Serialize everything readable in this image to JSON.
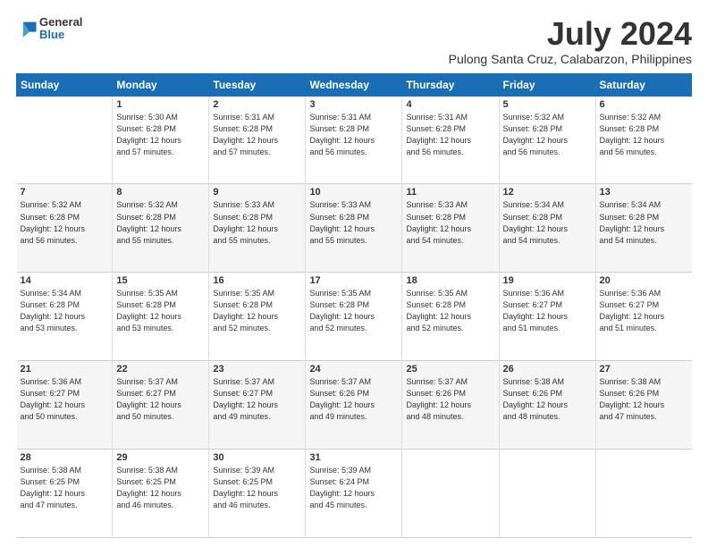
{
  "logo": {
    "general": "General",
    "blue": "Blue"
  },
  "title": "July 2024",
  "subtitle": "Pulong Santa Cruz, Calabarzon, Philippines",
  "days_header": [
    "Sunday",
    "Monday",
    "Tuesday",
    "Wednesday",
    "Thursday",
    "Friday",
    "Saturday"
  ],
  "weeks": [
    [
      {
        "num": "",
        "info": ""
      },
      {
        "num": "1",
        "info": "Sunrise: 5:30 AM\nSunset: 6:28 PM\nDaylight: 12 hours\nand 57 minutes."
      },
      {
        "num": "2",
        "info": "Sunrise: 5:31 AM\nSunset: 6:28 PM\nDaylight: 12 hours\nand 57 minutes."
      },
      {
        "num": "3",
        "info": "Sunrise: 5:31 AM\nSunset: 6:28 PM\nDaylight: 12 hours\nand 56 minutes."
      },
      {
        "num": "4",
        "info": "Sunrise: 5:31 AM\nSunset: 6:28 PM\nDaylight: 12 hours\nand 56 minutes."
      },
      {
        "num": "5",
        "info": "Sunrise: 5:32 AM\nSunset: 6:28 PM\nDaylight: 12 hours\nand 56 minutes."
      },
      {
        "num": "6",
        "info": "Sunrise: 5:32 AM\nSunset: 6:28 PM\nDaylight: 12 hours\nand 56 minutes."
      }
    ],
    [
      {
        "num": "7",
        "info": "Sunrise: 5:32 AM\nSunset: 6:28 PM\nDaylight: 12 hours\nand 56 minutes."
      },
      {
        "num": "8",
        "info": "Sunrise: 5:32 AM\nSunset: 6:28 PM\nDaylight: 12 hours\nand 55 minutes."
      },
      {
        "num": "9",
        "info": "Sunrise: 5:33 AM\nSunset: 6:28 PM\nDaylight: 12 hours\nand 55 minutes."
      },
      {
        "num": "10",
        "info": "Sunrise: 5:33 AM\nSunset: 6:28 PM\nDaylight: 12 hours\nand 55 minutes."
      },
      {
        "num": "11",
        "info": "Sunrise: 5:33 AM\nSunset: 6:28 PM\nDaylight: 12 hours\nand 54 minutes."
      },
      {
        "num": "12",
        "info": "Sunrise: 5:34 AM\nSunset: 6:28 PM\nDaylight: 12 hours\nand 54 minutes."
      },
      {
        "num": "13",
        "info": "Sunrise: 5:34 AM\nSunset: 6:28 PM\nDaylight: 12 hours\nand 54 minutes."
      }
    ],
    [
      {
        "num": "14",
        "info": "Sunrise: 5:34 AM\nSunset: 6:28 PM\nDaylight: 12 hours\nand 53 minutes."
      },
      {
        "num": "15",
        "info": "Sunrise: 5:35 AM\nSunset: 6:28 PM\nDaylight: 12 hours\nand 53 minutes."
      },
      {
        "num": "16",
        "info": "Sunrise: 5:35 AM\nSunset: 6:28 PM\nDaylight: 12 hours\nand 52 minutes."
      },
      {
        "num": "17",
        "info": "Sunrise: 5:35 AM\nSunset: 6:28 PM\nDaylight: 12 hours\nand 52 minutes."
      },
      {
        "num": "18",
        "info": "Sunrise: 5:35 AM\nSunset: 6:28 PM\nDaylight: 12 hours\nand 52 minutes."
      },
      {
        "num": "19",
        "info": "Sunrise: 5:36 AM\nSunset: 6:27 PM\nDaylight: 12 hours\nand 51 minutes."
      },
      {
        "num": "20",
        "info": "Sunrise: 5:36 AM\nSunset: 6:27 PM\nDaylight: 12 hours\nand 51 minutes."
      }
    ],
    [
      {
        "num": "21",
        "info": "Sunrise: 5:36 AM\nSunset: 6:27 PM\nDaylight: 12 hours\nand 50 minutes."
      },
      {
        "num": "22",
        "info": "Sunrise: 5:37 AM\nSunset: 6:27 PM\nDaylight: 12 hours\nand 50 minutes."
      },
      {
        "num": "23",
        "info": "Sunrise: 5:37 AM\nSunset: 6:27 PM\nDaylight: 12 hours\nand 49 minutes."
      },
      {
        "num": "24",
        "info": "Sunrise: 5:37 AM\nSunset: 6:26 PM\nDaylight: 12 hours\nand 49 minutes."
      },
      {
        "num": "25",
        "info": "Sunrise: 5:37 AM\nSunset: 6:26 PM\nDaylight: 12 hours\nand 48 minutes."
      },
      {
        "num": "26",
        "info": "Sunrise: 5:38 AM\nSunset: 6:26 PM\nDaylight: 12 hours\nand 48 minutes."
      },
      {
        "num": "27",
        "info": "Sunrise: 5:38 AM\nSunset: 6:26 PM\nDaylight: 12 hours\nand 47 minutes."
      }
    ],
    [
      {
        "num": "28",
        "info": "Sunrise: 5:38 AM\nSunset: 6:25 PM\nDaylight: 12 hours\nand 47 minutes."
      },
      {
        "num": "29",
        "info": "Sunrise: 5:38 AM\nSunset: 6:25 PM\nDaylight: 12 hours\nand 46 minutes."
      },
      {
        "num": "30",
        "info": "Sunrise: 5:39 AM\nSunset: 6:25 PM\nDaylight: 12 hours\nand 46 minutes."
      },
      {
        "num": "31",
        "info": "Sunrise: 5:39 AM\nSunset: 6:24 PM\nDaylight: 12 hours\nand 45 minutes."
      },
      {
        "num": "",
        "info": ""
      },
      {
        "num": "",
        "info": ""
      },
      {
        "num": "",
        "info": ""
      }
    ]
  ]
}
